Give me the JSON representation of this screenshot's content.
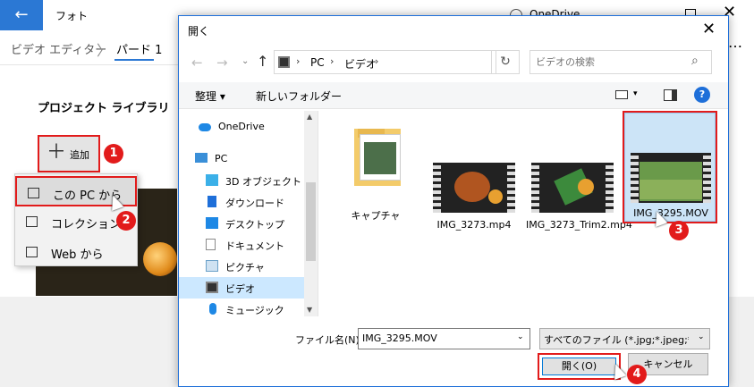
{
  "photos": {
    "back_icon": "←",
    "title": "フォト",
    "onedrive": "OneDrive",
    "close_icon": "✕",
    "more_icon": "…",
    "breadcrumb": {
      "editor": "ビデオ エディター",
      "chevron": "〉",
      "project": "パード 1"
    },
    "library_title": "プロジェクト ライブラリ",
    "add_button": {
      "icon": "＋",
      "label": "追加"
    },
    "context_menu": [
      {
        "label": "この PC から",
        "icon": "pc-icon"
      },
      {
        "label": "コレクションか",
        "icon": "collection-icon"
      },
      {
        "label": "Web から",
        "icon": "web-icon"
      }
    ]
  },
  "dialog": {
    "title": "開く",
    "close_icon": "✕",
    "nav_buttons": {
      "back": "←",
      "forward": "→",
      "recent": "⌄",
      "up": "↑"
    },
    "address": {
      "sep": "›",
      "pc": "PC",
      "folder": "ビデオ",
      "dropdown": "⌄",
      "refresh": "↻"
    },
    "search": {
      "placeholder": "ビデオの検索",
      "icon": "⌕"
    },
    "toolbar": {
      "organize": "整理 ▾",
      "new_folder": "新しいフォルダー",
      "view_dropdown": "▾",
      "help": "?"
    },
    "nav_items": [
      {
        "label": "OneDrive",
        "icon": "cloud-icon",
        "color": "#1e88e5"
      },
      {
        "label": "PC",
        "icon": "pc-icon",
        "color": "#3a8fd8"
      },
      {
        "label": "3D オブジェクト",
        "icon": "cube-icon",
        "color": "#3bb0e8"
      },
      {
        "label": "ダウンロード",
        "icon": "download-icon",
        "color": "#1e6fd9"
      },
      {
        "label": "デスクトップ",
        "icon": "desktop-icon",
        "color": "#1e88e5"
      },
      {
        "label": "ドキュメント",
        "icon": "document-icon",
        "color": "#8a8a8a"
      },
      {
        "label": "ピクチャ",
        "icon": "pictures-icon",
        "color": "#6aa0c8"
      },
      {
        "label": "ビデオ",
        "icon": "video-icon",
        "color": "#333333"
      },
      {
        "label": "ミュージック",
        "icon": "music-icon",
        "color": "#1e88e5"
      }
    ],
    "files": [
      {
        "name": "キャプチャ",
        "type": "folder"
      },
      {
        "name": "IMG_3273.mp4",
        "type": "video"
      },
      {
        "name": "IMG_3273_Trim2.mp4",
        "type": "video"
      },
      {
        "name": "IMG_3295.MOV",
        "type": "video",
        "selected": true
      }
    ],
    "filename_label": "ファイル名(N):",
    "filename_value": "IMG_3295.MOV",
    "filetype_value": "すべてのファイル (*.jpg;*.jpeg;*.thu",
    "open_button": "開く(O)",
    "cancel_button": "キャンセル"
  },
  "annotations": {
    "step1": "1",
    "step2": "2",
    "step3": "3",
    "step4": "4"
  },
  "colors": {
    "accent": "#2b78d4",
    "highlight": "#e21b1b",
    "selection": "#cce4f7"
  }
}
